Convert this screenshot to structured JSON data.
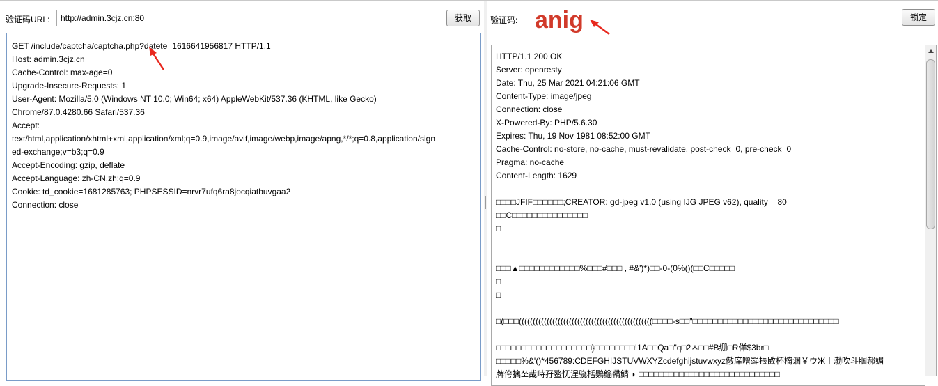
{
  "left": {
    "url_label": "验证码URL:",
    "url_value": "http://admin.3cjz.cn:80",
    "fetch_button": "获取",
    "request_lines": [
      "GET /include/captcha/captcha.php?datete=1616641956817 HTTP/1.1",
      "Host: admin.3cjz.cn",
      "Cache-Control: max-age=0",
      "Upgrade-Insecure-Requests: 1",
      "User-Agent: Mozilla/5.0 (Windows NT 10.0; Win64; x64) AppleWebKit/537.36 (KHTML, like Gecko)",
      "Chrome/87.0.4280.66 Safari/537.36",
      "Accept:",
      "text/html,application/xhtml+xml,application/xml;q=0.9,image/avif,image/webp,image/apng,*/*;q=0.8,application/sign",
      "ed-exchange;v=b3;q=0.9",
      "Accept-Encoding: gzip, deflate",
      "Accept-Language: zh-CN,zh;q=0.9",
      "Cookie: td_cookie=1681285763; PHPSESSID=nrvr7ufq6ra8jocqiatbuvgaa2",
      "Connection: close"
    ]
  },
  "right": {
    "captcha_label": "验证码:",
    "captcha_value": "anig",
    "lock_button": "锁定",
    "response_lines": [
      "HTTP/1.1 200 OK",
      "Server: openresty",
      "Date: Thu, 25 Mar 2021 04:21:06 GMT",
      "Content-Type: image/jpeg",
      "Connection: close",
      "X-Powered-By: PHP/5.6.30",
      "Expires: Thu, 19 Nov 1981 08:52:00 GMT",
      "Cache-Control: no-store, no-cache, must-revalidate, post-check=0, pre-check=0",
      "Pragma: no-cache",
      "Content-Length: 1629",
      "",
      "□□□□JFIF□□□□□□;CREATOR: gd-jpeg v1.0 (using IJG JPEG v62), quality = 80",
      "□□C□□□□□□□□□□□□□□□",
      "□",
      "",
      "",
      "□□□▲□□□□□□□□□□□□%□□□#□□□ , #&')*)□□-0-(0%()(□□C□□□□□",
      "□",
      "□",
      "",
      "□(□□□((((((((((((((((((((((((((((((((((((((((((((((((□□□□-s□□\"□□□□□□□□□□□□□□□□□□□□□□□□□□□□□",
      "",
      "□□□□□□□□□□□□□□□□□□□}□□□□□□□□!1A□□Qa□\"q□2ㅅ□□#B绷□R佯$3br□",
      "□□□□□%&'()*456789:CDEFGHIJSTUVWXYZcdefghijstuvwxyz儆庠噌斝掁敃柸橣涃￥ウЖ丨渤吹斗腘郝媚",
      "牌侉摛쏘哉畤孖鳌怃浧骁栝鷃鲻鞲鲭 ◗ □□□□□□□□□□□□□□□□□□□□□□□□□□□□"
    ]
  }
}
